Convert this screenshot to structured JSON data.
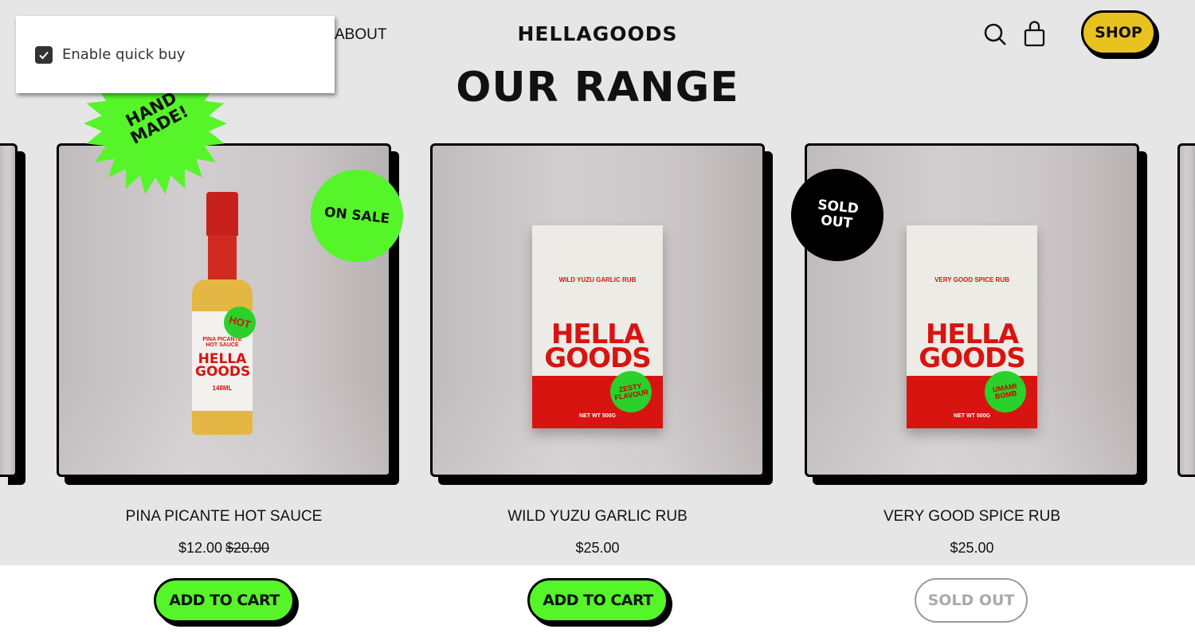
{
  "header": {
    "nav_about": "ABOUT",
    "logo": "HELLAGOODS",
    "search_icon": "search-icon",
    "cart_icon": "shopping-bag-icon",
    "shop_label": "SHOP"
  },
  "page_title": "OUR RANGE",
  "popup": {
    "checkbox_label": "Enable quick buy",
    "checked": true
  },
  "badges": {
    "hand_made": "HAND MADE!",
    "on_sale": "ON SALE",
    "sold_out": "SOLD OUT"
  },
  "colors": {
    "background": "#e6e6e6",
    "accent_green": "#55f52a",
    "shop_yellow": "#e8c31f",
    "brand_red": "#d71410"
  },
  "products": [
    {
      "name": "PINA PICANTE HOT SAUCE",
      "price": "$12.00",
      "compare_price": "$20.00",
      "button": "ADD TO CART",
      "label": {
        "sticker": "HOT",
        "flavour": "PINA PICANTE HOT SAUCE",
        "brand": "HELLA GOODS",
        "size": "148ML"
      }
    },
    {
      "name": "WILD YUZU GARLIC RUB",
      "price": "$25.00",
      "button": "ADD TO CART",
      "label": {
        "small": "WILD YUZU GARLIC RUB",
        "brand": "HELLA GOODS",
        "sticker": "ZESTY FLAVOUR",
        "net": "NET WT 500G"
      }
    },
    {
      "name": "VERY GOOD SPICE RUB",
      "price": "$25.00",
      "button": "SOLD OUT",
      "label": {
        "small": "VERY GOOD SPICE RUB",
        "brand": "HELLA GOODS",
        "sticker": "UMAMI BOMB",
        "net": "NET WT 500G"
      }
    }
  ]
}
